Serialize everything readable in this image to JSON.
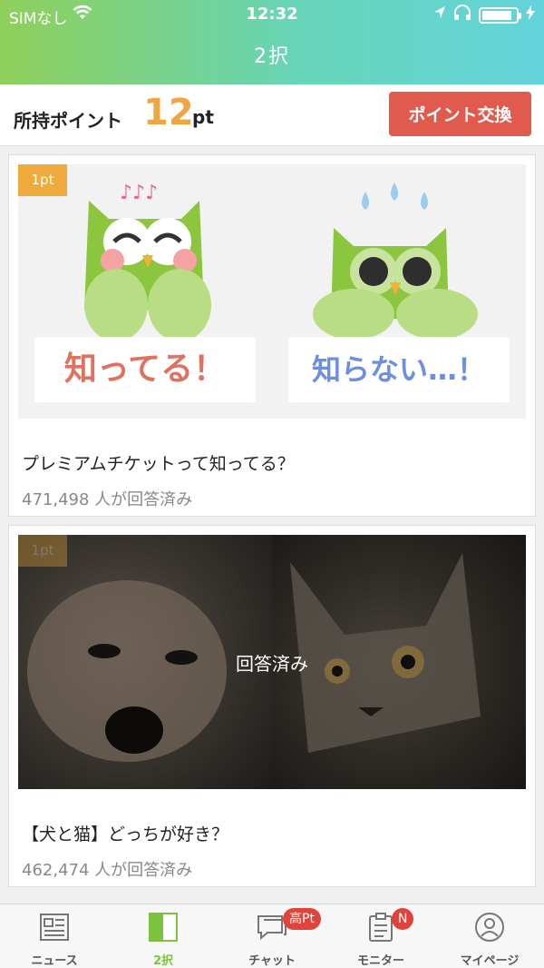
{
  "status": {
    "carrier": "SIMなし",
    "time": "12:32",
    "battery_level": 0.9
  },
  "header": {
    "title": "2択"
  },
  "points": {
    "label": "所持ポイント",
    "value": "12",
    "unit": "pt",
    "exchange_label": "ポイント交換"
  },
  "cards": [
    {
      "tag": "1pt",
      "option_a": "知ってる！",
      "option_b": "知らない…！",
      "question": "プレミアムチケットって知ってる？",
      "count": "471,498 人が回答済み"
    },
    {
      "tag": "1pt",
      "overlay": "回答済み",
      "question": "【犬と猫】どっちが好き？",
      "count": "462,474 人が回答済み"
    }
  ],
  "tabs": [
    {
      "label": "ニュース",
      "icon": "news-icon"
    },
    {
      "label": "2択",
      "icon": "two-choice-icon",
      "active": true
    },
    {
      "label": "チャット",
      "icon": "chat-icon",
      "badge": "高Pt"
    },
    {
      "label": "モニター",
      "icon": "monitor-icon",
      "badge": "N"
    },
    {
      "label": "マイページ",
      "icon": "profile-icon"
    }
  ],
  "colors": {
    "accent_green": "#7cc23e",
    "point_orange": "#f0a640",
    "exchange_red": "#e05a4e",
    "tag_orange": "#eeaa3a"
  }
}
